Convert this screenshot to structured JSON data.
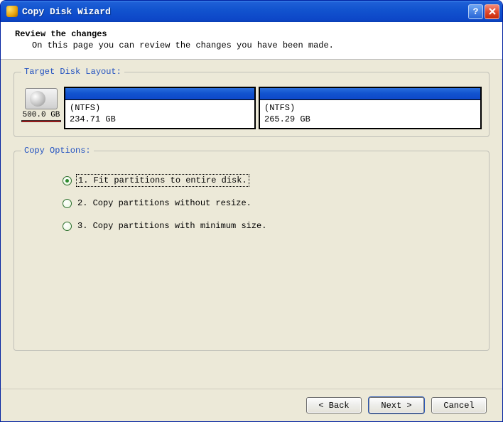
{
  "window": {
    "title": "Copy Disk Wizard"
  },
  "header": {
    "title": "Review the changes",
    "subtitle": "On this page you can review the changes you have been made."
  },
  "disk_layout": {
    "legend": "Target Disk Layout:",
    "disk_capacity": "500.0 GB",
    "partitions": [
      {
        "fs": "(NTFS)",
        "size": "234.71 GB"
      },
      {
        "fs": "(NTFS)",
        "size": "265.29 GB"
      }
    ]
  },
  "copy_options": {
    "legend": "Copy Options:",
    "options": [
      {
        "label": "1. Fit partitions to entire disk.",
        "selected": true
      },
      {
        "label": "2. Copy partitions without resize.",
        "selected": false
      },
      {
        "label": "3. Copy partitions with minimum size.",
        "selected": false
      }
    ]
  },
  "buttons": {
    "back": "< Back",
    "next": "Next >",
    "cancel": "Cancel"
  }
}
